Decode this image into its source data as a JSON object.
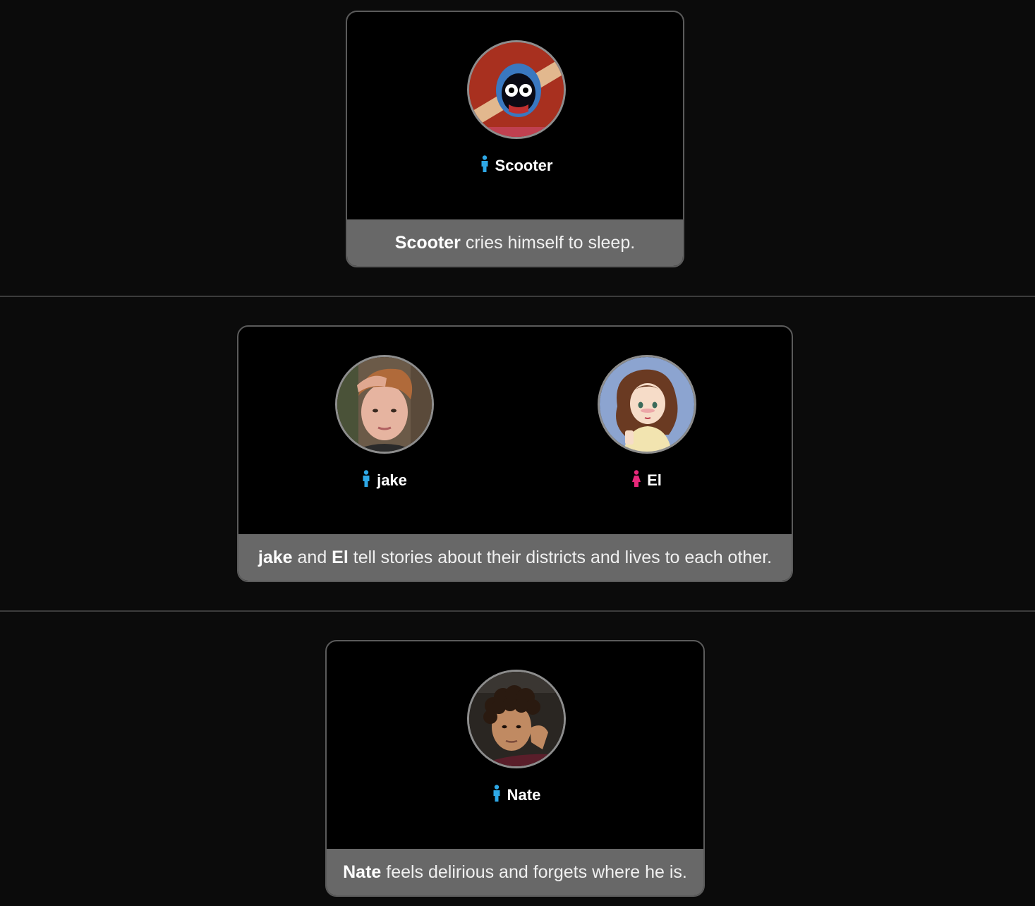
{
  "colors": {
    "background": "#0b0b0b",
    "card_background": "#000000",
    "caption_background": "#686868",
    "male_icon": "#2ea8e6",
    "female_icon": "#e8287a"
  },
  "events": [
    {
      "tributes": [
        {
          "name": "Scooter",
          "gender": "male",
          "avatar_icon": "hooded-character-avatar"
        }
      ],
      "caption": {
        "actor1": "Scooter",
        "text": " cries himself to sleep."
      }
    },
    {
      "tributes": [
        {
          "name": "jake",
          "gender": "male",
          "avatar_icon": "boy-photo-avatar"
        },
        {
          "name": "El",
          "gender": "female",
          "avatar_icon": "anime-girl-avatar"
        }
      ],
      "caption": {
        "actor1": "jake",
        "joiner": " and ",
        "actor2": "El",
        "text": " tell stories about their districts and lives to each other."
      }
    },
    {
      "tributes": [
        {
          "name": "Nate",
          "gender": "male",
          "avatar_icon": "curly-hair-boy-avatar"
        }
      ],
      "caption": {
        "actor1": "Nate",
        "text": " feels delirious and forgets where he is."
      }
    }
  ]
}
